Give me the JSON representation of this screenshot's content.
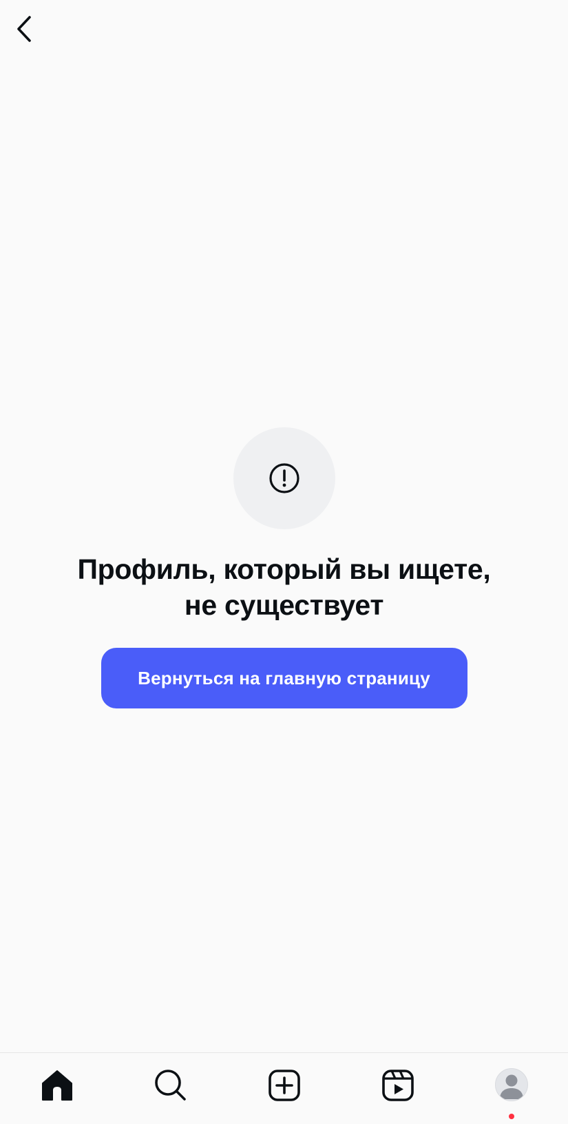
{
  "header": {
    "back_icon": "chevron-left-icon"
  },
  "error": {
    "icon": "alert-circle-icon",
    "title_line1": "Профиль, который вы ищете,",
    "title_line2": "не существует",
    "button_label": "Вернуться на главную страницу"
  },
  "bottom_nav": {
    "items": [
      {
        "icon": "home-icon",
        "active": true
      },
      {
        "icon": "search-icon",
        "active": false
      },
      {
        "icon": "create-icon",
        "active": false
      },
      {
        "icon": "reels-icon",
        "active": false
      },
      {
        "icon": "profile-avatar-icon",
        "active": false,
        "notification_dot": true
      }
    ]
  },
  "colors": {
    "background": "#fafafa",
    "primary_button": "#4a5df9",
    "icon_circle": "#eff0f2",
    "text": "#0c1014",
    "notification": "#ff3040"
  }
}
